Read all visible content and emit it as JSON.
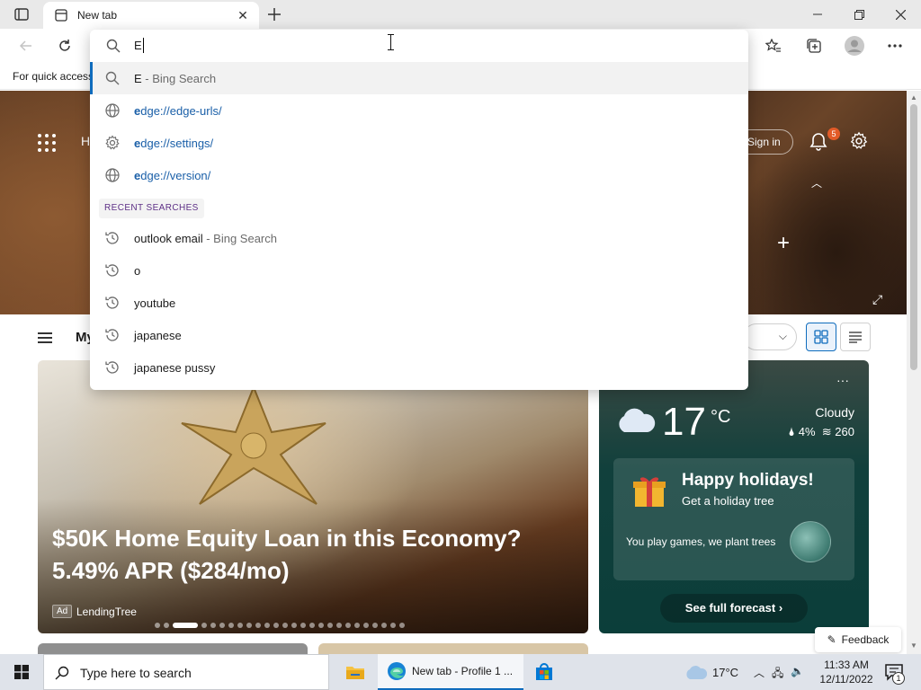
{
  "browser": {
    "tab": {
      "title": "New tab"
    },
    "favorites_bar": {
      "text": "For quick access"
    }
  },
  "omnibox": {
    "input_value": "E",
    "suggestions": [
      {
        "type": "search",
        "icon": "search-icon",
        "bold": "E",
        "suffix": " - Bing Search"
      },
      {
        "type": "url",
        "icon": "globe-icon",
        "bold": "e",
        "rest": "dge://edge-urls/"
      },
      {
        "type": "url",
        "icon": "gear-icon",
        "bold": "e",
        "rest": "dge://settings/"
      },
      {
        "type": "url",
        "icon": "globe-icon",
        "bold": "e",
        "rest": "dge://version/"
      }
    ],
    "recent_header": "RECENT SEARCHES",
    "recent": [
      {
        "text": "outlook email",
        "suffix": " - Bing Search"
      },
      {
        "text": "o",
        "suffix": ""
      },
      {
        "text": "youtube",
        "suffix": ""
      },
      {
        "text": "japanese",
        "suffix": ""
      },
      {
        "text": "japanese pussy",
        "suffix": ""
      }
    ]
  },
  "newtab": {
    "hero_partial": "H",
    "signin": "Sign in",
    "notification_count": "5",
    "feed_partial_title": "My",
    "headline": "$50K Home Equity Loan in this Economy? 5.49% APR ($284/mo)",
    "ad_badge": "Ad",
    "ad_source": "LendingTree",
    "carousel": {
      "count": 26,
      "active": 2
    },
    "weather": {
      "temp": "17",
      "unit": "°C",
      "condition": "Cloudy",
      "precip": "4%",
      "aqi": "260",
      "promo_title": "Happy holidays!",
      "promo_sub": "Get a holiday tree",
      "promo_line": "You play games, we plant trees",
      "forecast_btn": "See full forecast"
    },
    "feedback": "Feedback"
  },
  "taskbar": {
    "search_placeholder": "Type here to search",
    "active_app": "New tab - Profile 1 ...",
    "weather": "17°C",
    "time": "11:33 AM",
    "date": "12/11/2022",
    "notification_count": "1"
  },
  "colors": {
    "accent": "#0f6cbd",
    "badge": "#e35b28",
    "recent_header": "#5d2f86",
    "url": "#1a5fa8"
  }
}
